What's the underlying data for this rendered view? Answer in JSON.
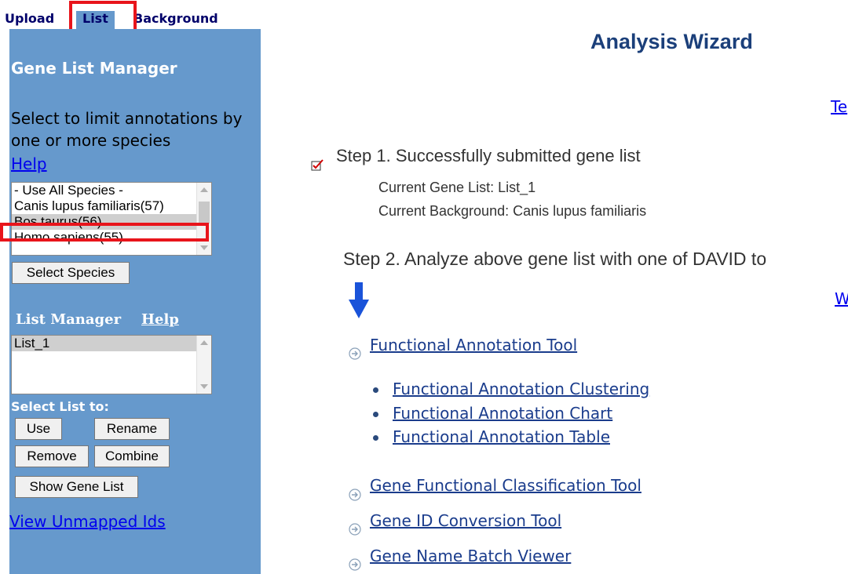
{
  "tabs": [
    {
      "label": "Upload"
    },
    {
      "label": "List"
    },
    {
      "label": "Background"
    }
  ],
  "sidebar": {
    "title": "Gene List Manager",
    "instructions": "Select to limit annotations by one or more species",
    "help": "Help",
    "species_options": [
      "- Use All Species -",
      "Canis lupus familiaris(57)",
      "Bos taurus(56)",
      "Homo sapiens(55)"
    ],
    "species_selected": "Bos taurus(56)",
    "select_species_button": "Select Species",
    "list_manager_title": "List Manager",
    "list_manager_help": "Help",
    "lists": [
      "List_1"
    ],
    "select_list_label": "Select List to:",
    "buttons": {
      "use": "Use",
      "rename": "Rename",
      "remove": "Remove",
      "combine": "Combine",
      "show_gene_list": "Show Gene List"
    },
    "view_unmapped": "View Unmapped Ids"
  },
  "main": {
    "title": "Analysis Wizard",
    "right_link_1": "Te",
    "right_link_2": "W",
    "step1": "Step 1. Successfully submitted gene list",
    "current_gene_list": "Current Gene List: List_1",
    "current_background": "Current Background: Canis lupus familiaris",
    "step2": "Step 2. Analyze above gene list with one of DAVID to",
    "tools": {
      "functional_annotation_tool": "Functional Annotation Tool",
      "sub": [
        "Functional Annotation Clustering",
        "Functional Annotation Chart",
        "Functional Annotation Table"
      ],
      "gene_functional_classification": "Gene Functional Classification Tool",
      "gene_id_conversion": "Gene ID Conversion Tool",
      "gene_name_batch_viewer": "Gene Name Batch Viewer"
    }
  },
  "colors": {
    "sidebar_bg": "#6699cc",
    "highlight": "#e8141b",
    "title": "#1b3f7a",
    "link": "#1a3c8c"
  }
}
